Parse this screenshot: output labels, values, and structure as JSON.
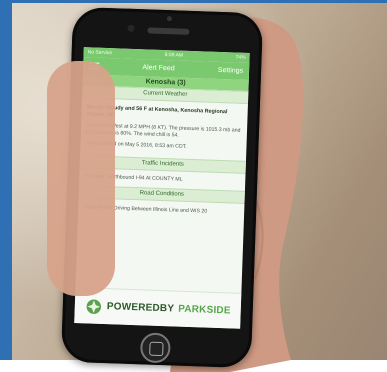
{
  "status_bar": {
    "carrier": "No Service",
    "time": "8:08 AM",
    "battery": "74%"
  },
  "nav": {
    "title": "Alert Feed",
    "settings_label": "Settings"
  },
  "location": "Kenosha (3)",
  "sections": {
    "weather_header": "Current Weather",
    "weather_title": "Mostly Cloudy and 56 F at Kenosha, Kenosha Regional Airport, WI",
    "weather_body": "Winds are West at 9.2 MPH (8 KT). The pressure is 1015.3 mb and the humidity is 80%. The wind chill is 54.",
    "weather_updated": "Last Updated on May 5 2016, 8:53 am CDT.",
    "traffic_header": "Traffic Incidents",
    "traffic_text": "Accident: Northbound I-94 At COUNTY ML",
    "road_header": "Road Conditions",
    "road_text": "Good Winter Driving Between Illinois Line and WIS 20"
  },
  "brand": {
    "text_1": "POWEREDBY",
    "text_2": "PARKSIDE"
  },
  "colors": {
    "accent": "#7bc96f",
    "section_bg": "#dbeed4",
    "frame": "#2f6fb4"
  }
}
